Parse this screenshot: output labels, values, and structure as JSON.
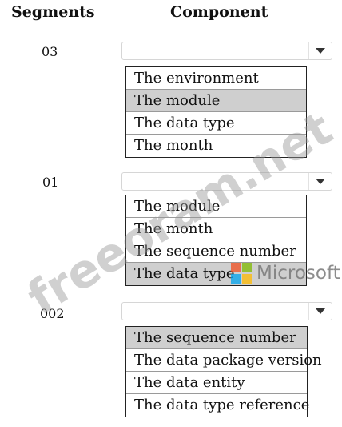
{
  "headers": {
    "segments": "Segments",
    "component": "Component"
  },
  "rows": [
    {
      "segment": "03",
      "selected": "",
      "options": [
        "The environment",
        "The module",
        "The data type",
        "The month"
      ],
      "highlighted_index": 1
    },
    {
      "segment": "01",
      "selected": "",
      "options": [
        "The module",
        "The month",
        "The sequence number",
        "The data type"
      ],
      "highlighted_index": 3
    },
    {
      "segment": "002",
      "selected": "",
      "options": [
        "The sequence number",
        "The data package version",
        "The data entity",
        "The data type reference"
      ],
      "highlighted_index": 0
    }
  ],
  "watermark": {
    "site": "freeoram.net",
    "brand": "Microsoft"
  },
  "colors": {
    "highlight": "#cfcfcf",
    "ms_red": "#f25022",
    "ms_green": "#7fba00",
    "ms_blue": "#00a4ef",
    "ms_yellow": "#ffb900"
  },
  "icons": {
    "dropdown_arrow": "chevron-down-icon"
  }
}
